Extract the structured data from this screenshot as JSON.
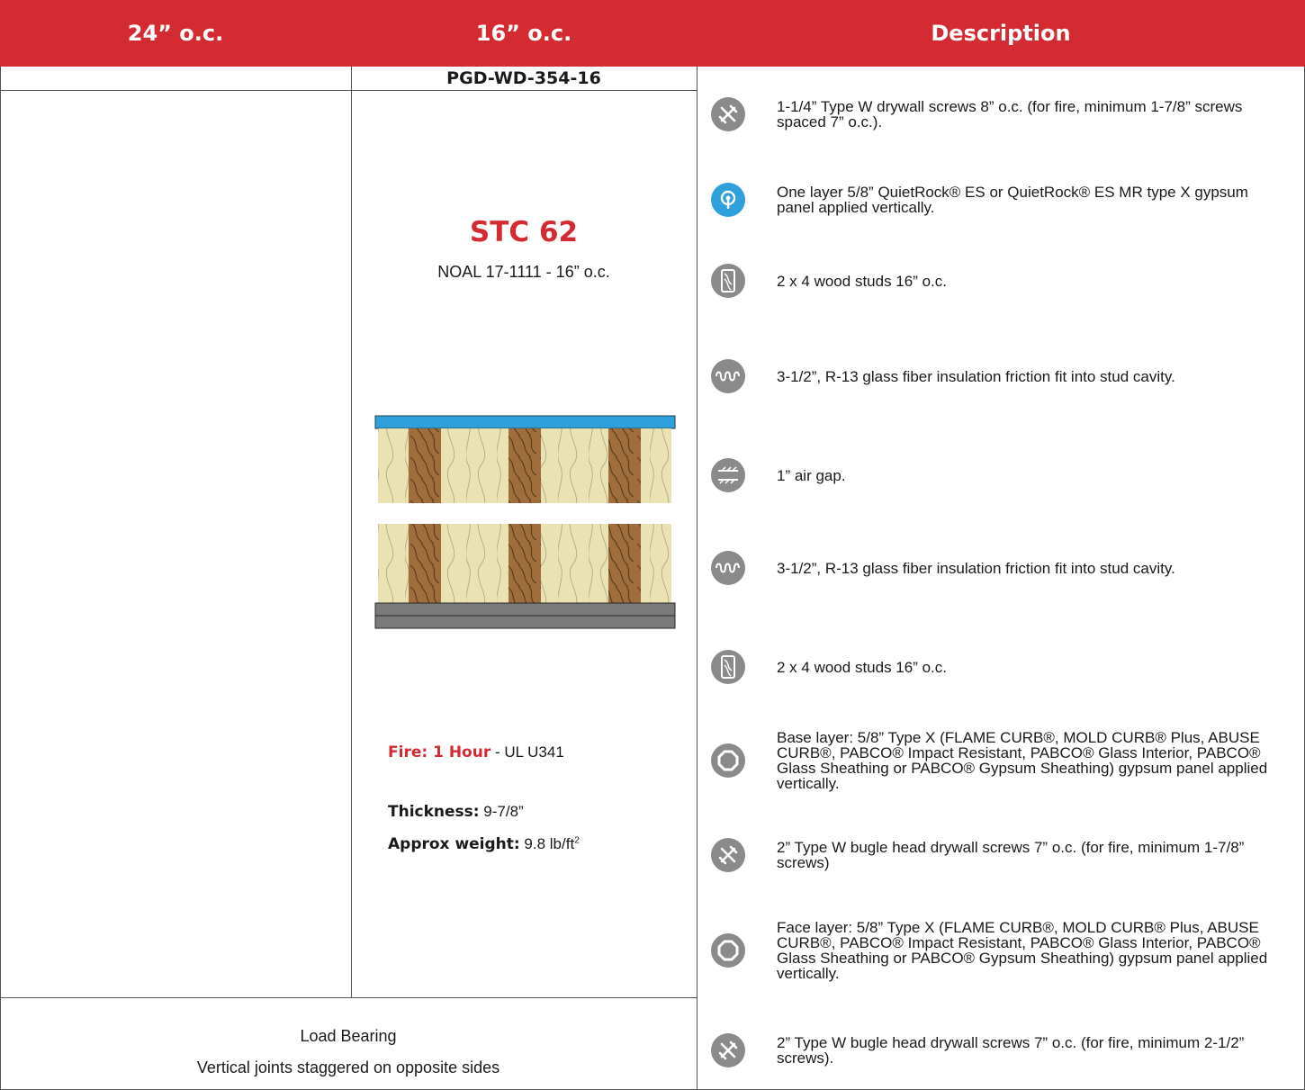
{
  "header": {
    "col1": "24” o.c.",
    "col2": "16” o.c.",
    "col3": "Description"
  },
  "assembly": {
    "code": "PGD-WD-354-16",
    "stc": "STC 62",
    "noal": "NOAL 17-1111  - 16” o.c.",
    "fire_label": "Fire: 1 Hour",
    "fire_rest": " - UL U341",
    "thickness_label": "Thickness:",
    "thickness_value": " 9-7/8”",
    "weight_label": "Approx weight:",
    "weight_value": " 9.8 lb/ft",
    "weight_sup": "2"
  },
  "notes": {
    "line1": "Load Bearing",
    "line2": "Vertical joints staggered on opposite sides"
  },
  "colors": {
    "header_red": "#d42a32",
    "panel_blue": "#2fa0dc",
    "icon_gray": "#8a8a8a"
  },
  "description": [
    {
      "icon": "tools-icon",
      "text": "1-1/4” Type W drywall screws 8” o.c. (for fire, minimum 1-7/8” screws spaced 7” o.c.)."
    },
    {
      "icon": "quietrock-icon",
      "text": "One layer 5/8” QuietRock® ES or QuietRock® ES MR type X gypsum panel applied vertically."
    },
    {
      "icon": "wood-stud-icon",
      "text": "2 x 4 wood studs 16” o.c."
    },
    {
      "icon": "insulation-icon",
      "text": "3-1/2”, R-13 glass fiber insulation friction fit into stud cavity."
    },
    {
      "icon": "air-gap-icon",
      "text": "1” air gap."
    },
    {
      "icon": "insulation-icon",
      "text": "3-1/2”, R-13 glass fiber insulation friction fit into stud cavity."
    },
    {
      "icon": "wood-stud-icon",
      "text": " 2 x 4 wood studs 16” o.c."
    },
    {
      "icon": "gypsum-panel-icon",
      "text": "Base layer: 5/8” Type X (FLAME CURB®, MOLD CURB® Plus, ABUSE CURB®, PABCO® Impact Resistant, PABCO® Glass Interior, PABCO® Glass Sheathing or PABCO® Gypsum Sheathing) gypsum panel applied vertically."
    },
    {
      "icon": "tools-icon",
      "text": "2” Type W bugle head drywall screws 7” o.c. (for fire, minimum 1-7/8” screws)"
    },
    {
      "icon": "gypsum-panel-icon",
      "text": "Face layer: 5/8” Type X (FLAME CURB®, MOLD CURB® Plus, ABUSE CURB®, PABCO® Impact Resistant, PABCO® Glass Interior, PABCO® Glass Sheathing or PABCO® Gypsum Sheathing) gypsum panel applied vertically."
    },
    {
      "icon": "tools-icon",
      "text": "2” Type W bugle head drywall screws 7” o.c. (for fire, minimum 2-1/2” screws)."
    }
  ]
}
